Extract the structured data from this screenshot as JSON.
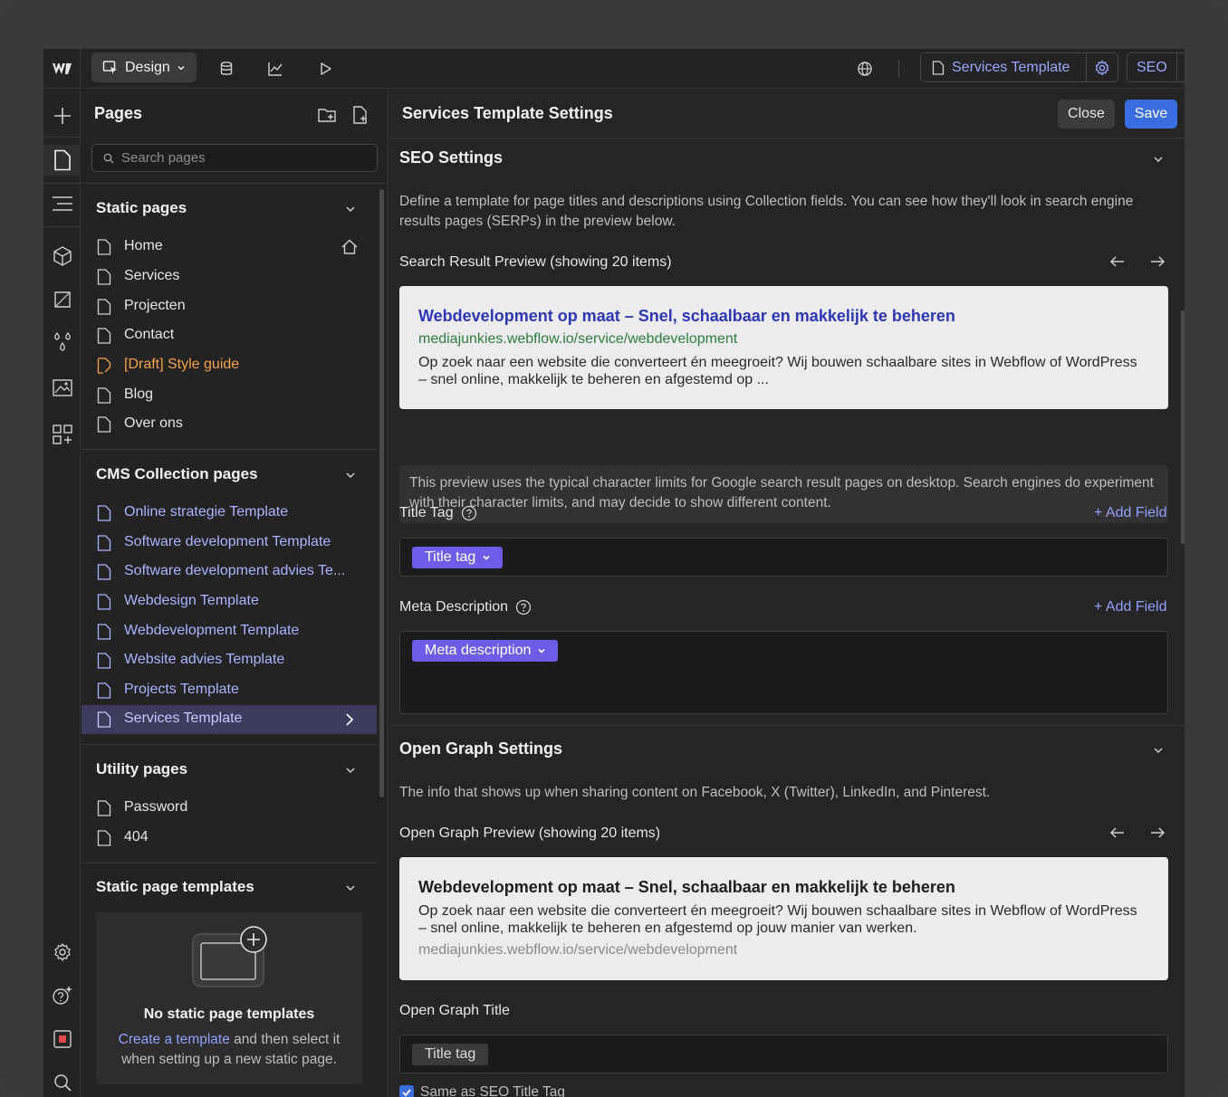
{
  "topbar": {
    "mode_label": "Design",
    "current_page": "Services Template",
    "seo_label": "SEO"
  },
  "pages_panel": {
    "title": "Pages",
    "search_placeholder": "Search pages",
    "static": {
      "title": "Static pages",
      "items": [
        "Home",
        "Services",
        "Projecten",
        "Contact",
        "[Draft] Style guide",
        "Blog",
        "Over ons"
      ]
    },
    "cms": {
      "title": "CMS Collection pages",
      "items": [
        "Online strategie Template",
        "Software development Template",
        "Software development advies Te...",
        "Webdesign Template",
        "Webdevelopment Template",
        "Website advies Template",
        "Projects Template",
        "Services Template"
      ]
    },
    "utility": {
      "title": "Utility pages",
      "items": [
        "Password",
        "404"
      ]
    },
    "templates": {
      "title": "Static page templates",
      "empty_title": "No static page templates",
      "empty_link": "Create a template",
      "empty_text": " and then select it when setting up a new static page."
    }
  },
  "settings": {
    "title": "Services Template Settings",
    "close_label": "Close",
    "save_label": "Save",
    "seo": {
      "title": "SEO Settings",
      "description": "Define a template for page titles and descriptions using Collection fields. You can see how they'll look in search engine results pages (SERPs) in the preview below.",
      "preview_label": "Search Result Preview (showing 20 items)",
      "preview_title": "Webdevelopment op maat – Snel, schaalbaar en makkelijk te beheren",
      "preview_url": "mediajunkies.webflow.io/service/webdevelopment",
      "preview_body": "Op zoek naar een website die converteert én meegroeit? Wij bouwen schaalbare sites in Webflow of WordPress – snel online, makkelijk te beheren en afgestemd op ...",
      "note": "This preview uses the typical character limits for Google search result pages on desktop. Search engines do experiment with their character limits, and may decide to show different content.",
      "title_tag_label": "Title Tag",
      "title_tag_pill": "Title tag",
      "meta_label": "Meta Description",
      "meta_pill": "Meta description",
      "add_field": "+ Add Field"
    },
    "og": {
      "title": "Open Graph Settings",
      "description": "The info that shows up when sharing content on Facebook, X (Twitter), LinkedIn, and Pinterest.",
      "preview_label": "Open Graph Preview (showing 20 items)",
      "preview_title": "Webdevelopment op maat – Snel, schaalbaar en makkelijk te beheren",
      "preview_body": "Op zoek naar een website die converteert én meegroeit? Wij bouwen schaalbare sites in Webflow of WordPress – snel online, makkelijk te beheren en afgestemd op jouw manier van werken.",
      "preview_url": "mediajunkies.webflow.io/service/webdevelopment",
      "og_title_label": "Open Graph Title",
      "og_title_pill": "Title tag",
      "same_as_label": "Same as SEO Title Tag"
    }
  },
  "colors": {
    "accent": "#3a6de0",
    "pill": "#6c5ce7",
    "cms_link": "#aab3ff",
    "draft": "#f3a14b"
  }
}
